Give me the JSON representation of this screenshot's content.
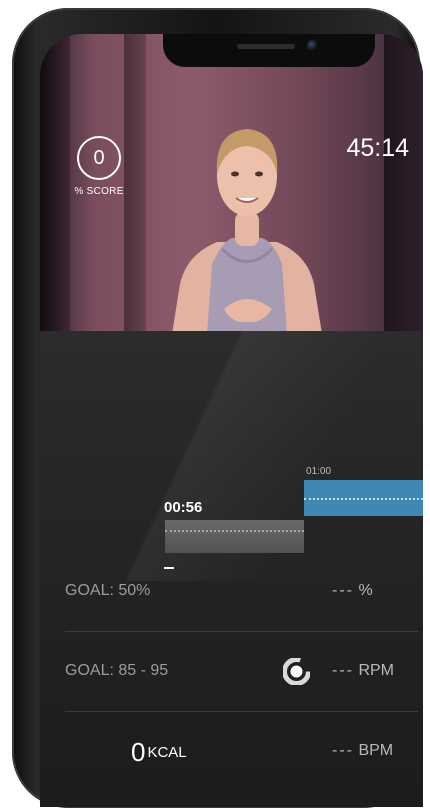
{
  "video": {
    "score_value": "0",
    "score_label": "% SCORE",
    "elapsed_time": "45:14"
  },
  "segments": {
    "current_time": "00:56",
    "next_time": "01:00"
  },
  "metrics": {
    "row1": {
      "goal_label": "GOAL: 50%",
      "value": "---",
      "unit": "%"
    },
    "row2": {
      "goal_label": "GOAL:  85 - 95",
      "value": "---",
      "unit": "RPM",
      "icon": "cadence-ring-icon"
    },
    "row3": {
      "calories_value": "0",
      "calories_unit": "KCAL",
      "value": "---",
      "unit": "BPM"
    }
  },
  "colors": {
    "next_segment": "#3f88b4",
    "current_segment": "#5e5e5e"
  }
}
